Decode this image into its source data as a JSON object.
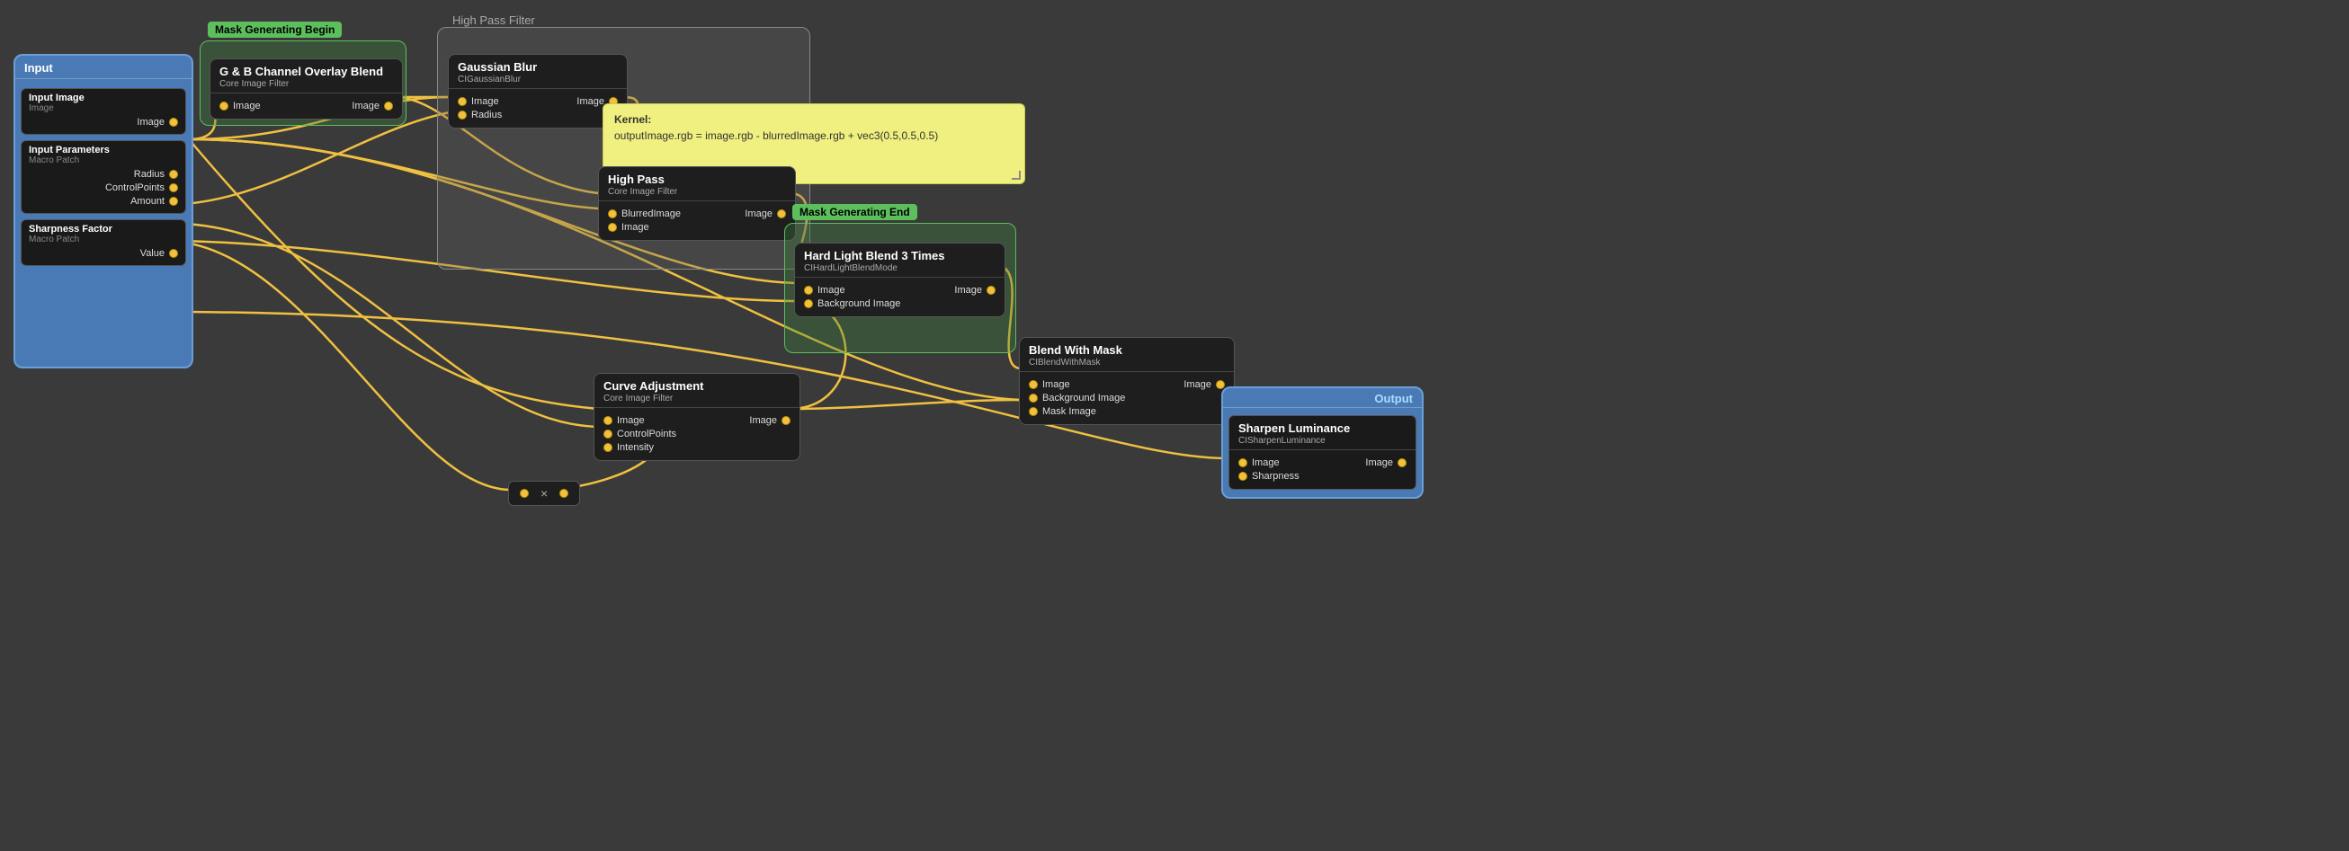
{
  "nodes": {
    "input_container": {
      "title": "Input",
      "sections": [
        {
          "id": "input_image",
          "title": "Input Image",
          "subtitle": "Image",
          "port": "Image"
        },
        {
          "id": "input_parameters",
          "title": "Input Parameters",
          "subtitle": "Macro Patch",
          "ports": [
            "Radius",
            "ControlPoints",
            "Amount"
          ]
        },
        {
          "id": "sharpness_factor",
          "title": "Sharpness Factor",
          "subtitle": "Macro Patch",
          "ports": [
            "Value"
          ]
        }
      ]
    },
    "gb_blend": {
      "title": "G & B Channel Overlay Blend",
      "subtitle": "Core Image Filter",
      "inputs": [
        "Image"
      ],
      "outputs": [
        "Image"
      ]
    },
    "gaussian_blur": {
      "title": "Gaussian Blur",
      "subtitle": "CIGaussianBlur",
      "inputs": [
        "Image",
        "Radius"
      ],
      "outputs": [
        "Image"
      ]
    },
    "high_pass": {
      "title": "High Pass",
      "subtitle": "Core Image Filter",
      "inputs": [
        "BlurredImage",
        "Image"
      ],
      "outputs": [
        "Image"
      ]
    },
    "kernel_note": {
      "label": "Kernel:",
      "formula": "outputImage.rgb =  image.rgb - blurredImage.rgb + vec3(0.5,0.5,0.5)"
    },
    "hard_light": {
      "title": "Hard Light Blend 3 Times",
      "subtitle": "CIHardLightBlendMode",
      "inputs": [
        "Image",
        "Background Image"
      ],
      "outputs": [
        "Image"
      ]
    },
    "curve_adjustment": {
      "title": "Curve Adjustment",
      "subtitle": "Core Image Filter",
      "inputs": [
        "Image",
        "ControlPoints",
        "Intensity"
      ],
      "outputs": [
        "Image"
      ]
    },
    "blend_with_mask": {
      "title": "Blend With Mask",
      "subtitle": "CIBlendWithMask",
      "inputs": [
        "Image",
        "Background Image",
        "Mask Image"
      ],
      "outputs": [
        "Image"
      ]
    },
    "sharpen_luminance": {
      "title": "Sharpen Luminance",
      "subtitle": "CISharpenLuminance",
      "inputs": [
        "Image",
        "Sharpness"
      ],
      "outputs": [
        "Image"
      ]
    },
    "multiply": {
      "symbol": "×"
    },
    "containers": {
      "mask_begin": "Mask Generating Begin",
      "high_pass_filter": "High Pass Filter",
      "mask_end": "Mask Generating End"
    },
    "output_label": "Output"
  }
}
